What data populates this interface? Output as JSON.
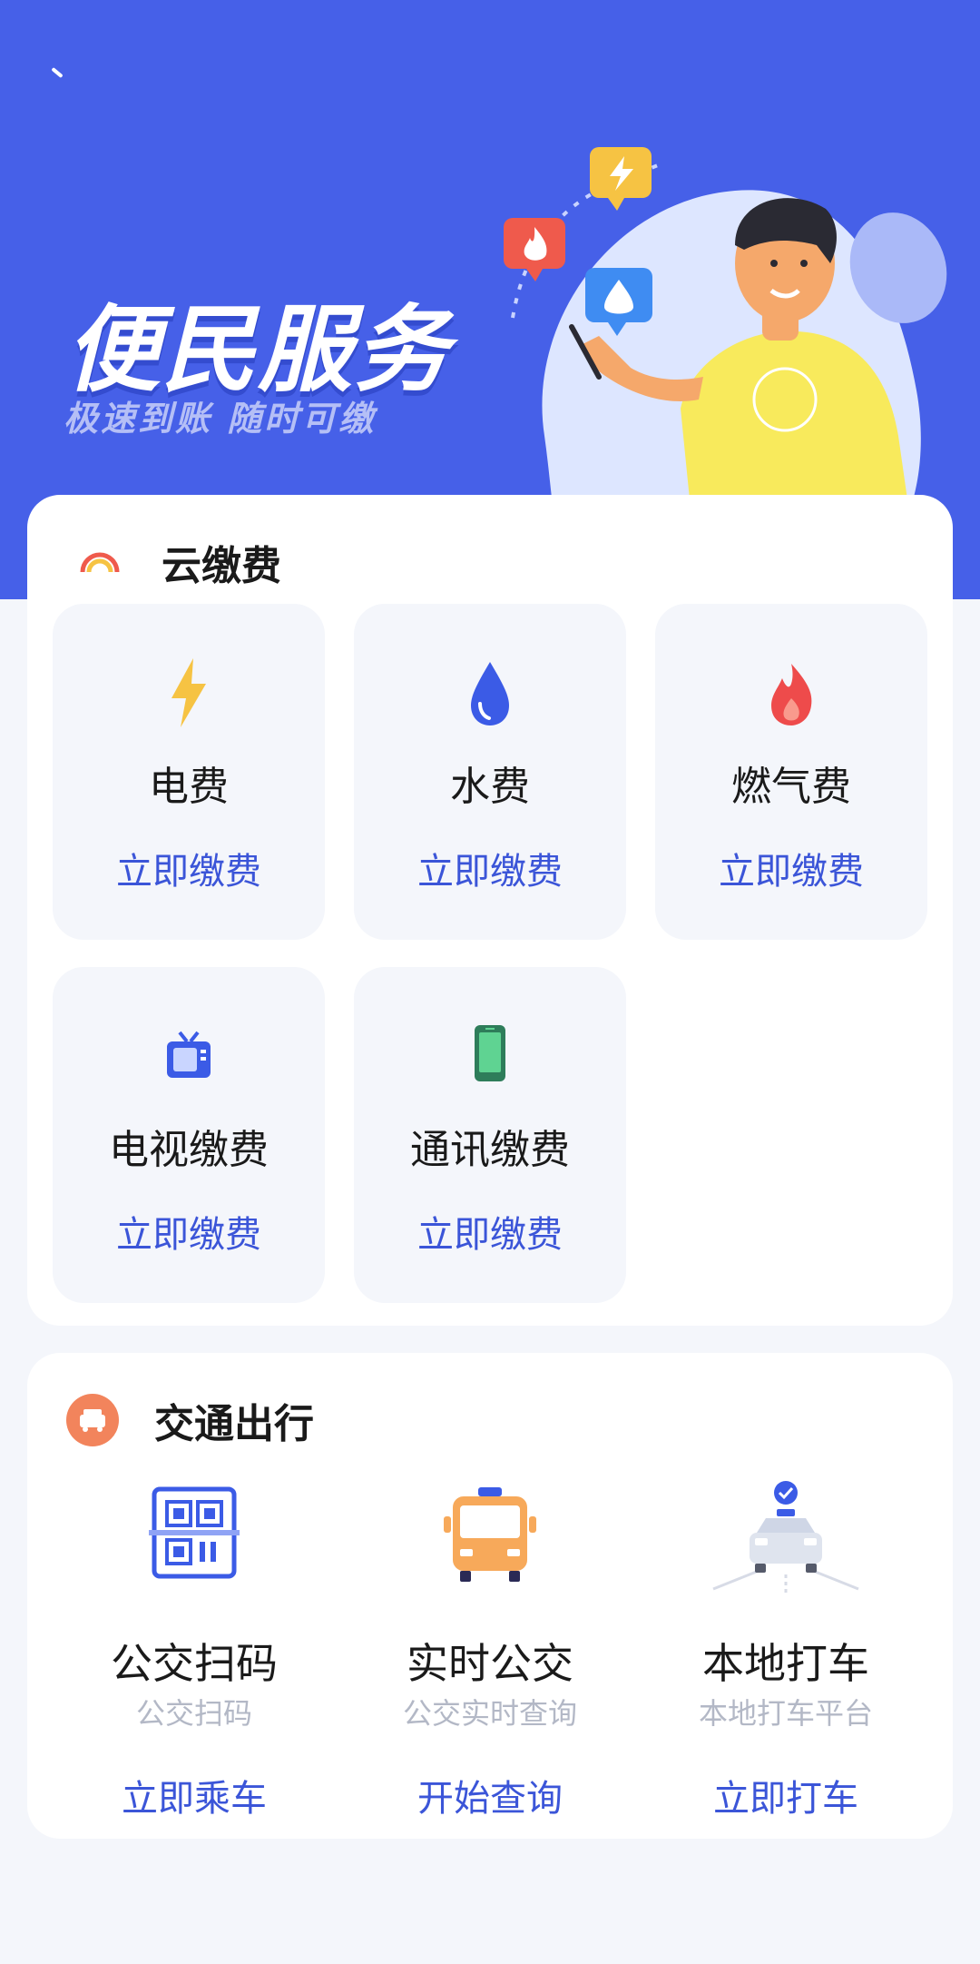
{
  "banner": {
    "title": "便民服务",
    "subtitle": "极速到账  随时可缴"
  },
  "cloud_pay": {
    "title": "云缴费",
    "items": [
      {
        "icon": "lightning-icon",
        "name": "电费",
        "action": "立即缴费"
      },
      {
        "icon": "water-drop-icon",
        "name": "水费",
        "action": "立即缴费"
      },
      {
        "icon": "flame-icon",
        "name": "燃气费",
        "action": "立即缴费"
      },
      {
        "icon": "tv-icon",
        "name": "电视缴费",
        "action": "立即缴费"
      },
      {
        "icon": "phone-icon",
        "name": "通讯缴费",
        "action": "立即缴费"
      }
    ]
  },
  "transport": {
    "title": "交通出行",
    "items": [
      {
        "icon": "qr-scan-icon",
        "name": "公交扫码",
        "desc": "公交扫码",
        "action": "立即乘车"
      },
      {
        "icon": "bus-icon",
        "name": "实时公交",
        "desc": "公交实时查询",
        "action": "开始查询"
      },
      {
        "icon": "taxi-icon",
        "name": "本地打车",
        "desc": "本地打车平台",
        "action": "立即打车"
      }
    ]
  },
  "colors": {
    "brand_blue": "#4660e8",
    "action_blue": "#3b55d8",
    "tile_bg": "#f4f6fb"
  }
}
